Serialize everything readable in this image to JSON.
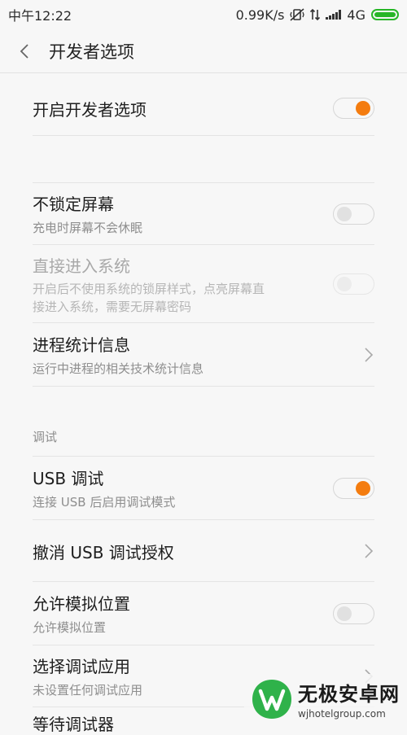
{
  "status": {
    "time": "中午12:22",
    "speed": "0.99K/s",
    "network": "4G",
    "battery_color": "#27b627"
  },
  "header": {
    "back_icon": "chevron-left-icon",
    "title": "开发者选项"
  },
  "settings": {
    "developer_options": {
      "label": "开启开发者选项",
      "toggle": "on"
    },
    "stay_awake": {
      "label": "不锁定屏幕",
      "sub": "充电时屏幕不会休眠",
      "toggle": "off"
    },
    "direct_enter": {
      "label": "直接进入系统",
      "sub1": "开启后不使用系统的锁屏样式，点亮屏幕直",
      "sub2": "接进入系统，需要无屏幕密码",
      "toggle": "off-disabled"
    },
    "process_stats": {
      "label": "进程统计信息",
      "sub": "运行中进程的相关技术统计信息"
    },
    "debug_section": "调试",
    "usb_debug": {
      "label": "USB 调试",
      "sub": "连接 USB 后启用调试模式",
      "toggle": "on"
    },
    "revoke_usb": {
      "label": "撤消 USB 调试授权"
    },
    "mock_location": {
      "label": "允许模拟位置",
      "sub": "允许模拟位置",
      "toggle": "off"
    },
    "debug_app": {
      "label": "选择调试应用",
      "sub": "未设置任何调试应用"
    },
    "partial_next": "等待调试器"
  },
  "watermark": {
    "name": "无极安卓网",
    "url": "wjhotelgroup.com",
    "logo_color": "#2fb24a"
  },
  "colors": {
    "accent": "#f47c0f",
    "background": "#f7f7f7"
  }
}
